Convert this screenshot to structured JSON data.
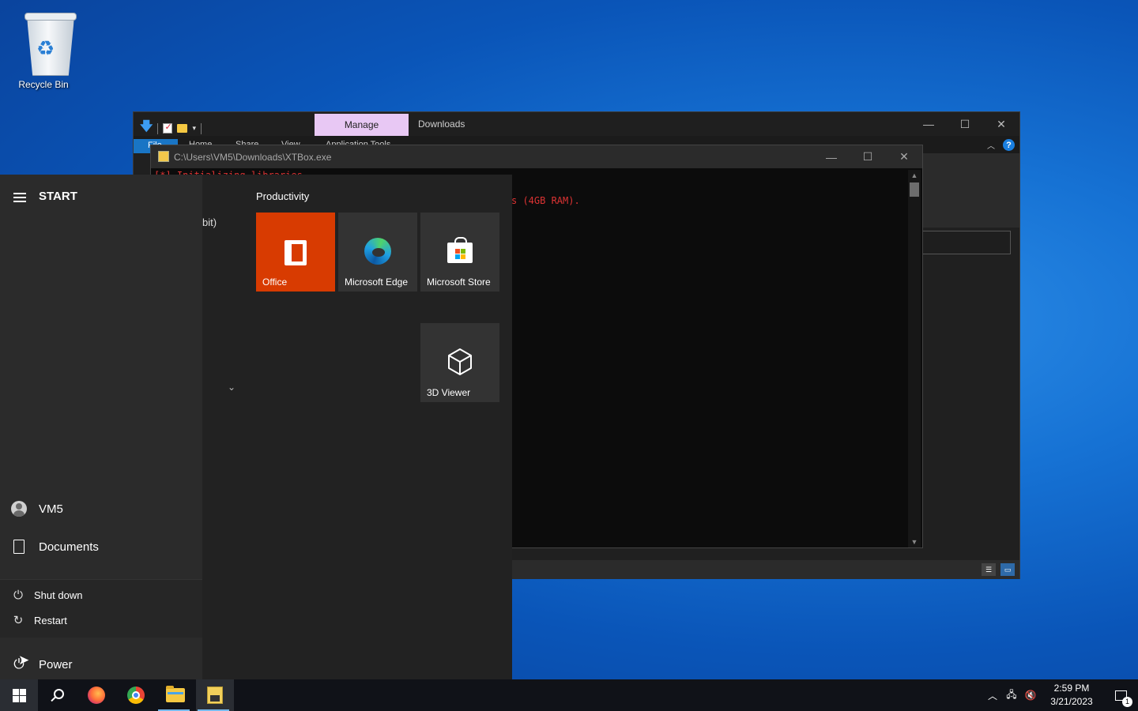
{
  "desktop": {
    "recycle_bin_label": "Recycle Bin"
  },
  "explorer": {
    "title": "Downloads",
    "manage_tab": "Manage",
    "ribbon_tabs": [
      "File",
      "Home",
      "Share",
      "View",
      "Application Tools"
    ],
    "controls": {
      "minimize": "—",
      "maximize": "☐",
      "close": "✕"
    }
  },
  "console": {
    "title": "C:\\Users\\VM5\\Downloads\\XTBox.exe",
    "line1": "[*] Initializing libraries",
    "line2": "s (4GB RAM).",
    "controls": {
      "minimize": "—",
      "maximize": "☐",
      "close": "✕"
    }
  },
  "start_menu": {
    "title": "START",
    "app_list_fragment": "bit)",
    "user_name": "VM5",
    "documents_label": "Documents",
    "power_menu": {
      "shutdown_label": "Shut down",
      "restart_label": "Restart"
    },
    "power_label": "Power",
    "group_title": "Productivity",
    "tiles": {
      "office": "Office",
      "edge": "Microsoft Edge",
      "store": "Microsoft Store",
      "viewer3d": "3D Viewer"
    }
  },
  "taskbar": {
    "apps": [
      "start",
      "search",
      "firefox",
      "chrome",
      "file-explorer",
      "xtbox-console"
    ],
    "time": "2:59 PM",
    "date": "3/21/2023",
    "notification_count": "1"
  },
  "colors": {
    "office_tile": "#d83b01",
    "manage_tab": "#e8c8f4",
    "console_text": "#dd3333",
    "file_tab": "#1975c5"
  }
}
